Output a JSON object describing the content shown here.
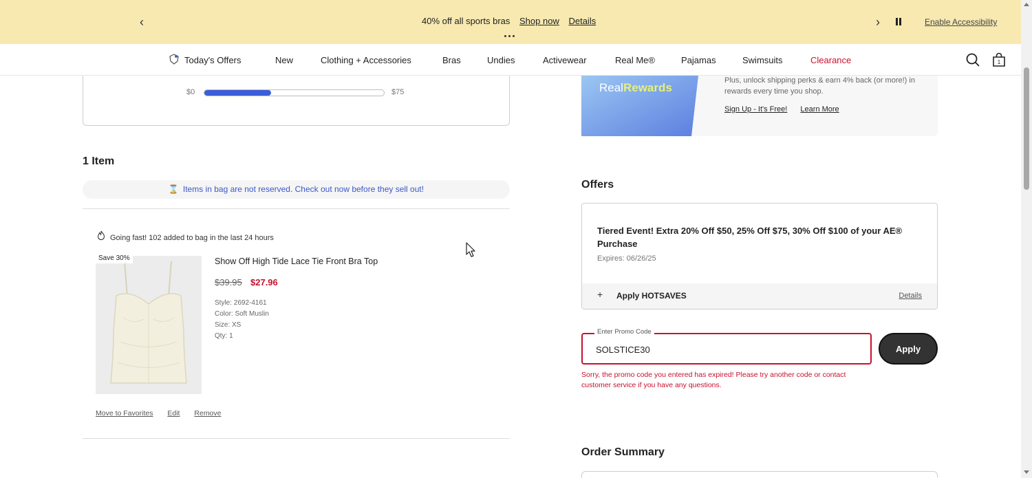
{
  "promo_bar": {
    "message": "40% off all sports bras",
    "shop_now": "Shop now",
    "details": "Details",
    "accessibility": "Enable Accessibility",
    "prev_icon": "chevron-left-icon",
    "next_icon": "chevron-right-icon",
    "pause_icon": "pause-icon"
  },
  "nav": {
    "items": [
      "Today's Offers",
      "New",
      "Clothing + Accessories",
      "Bras",
      "Undies",
      "Activewear",
      "Real Me®",
      "Pajamas",
      "Swimsuits",
      "Clearance"
    ],
    "bag_count": "1",
    "clearance_color": "#c8102e"
  },
  "progress": {
    "min_label": "$0",
    "max_label": "$75",
    "fraction": 0.37
  },
  "cart": {
    "heading": "1 Item",
    "reserve_notice": "Items in bag are not reserved. Check out now before they sell out!",
    "going_fast": "Going fast! 102 added to bag in the last 24 hours",
    "item": {
      "save_tag": "Save 30%",
      "name": "Show Off High Tide Lace Tie Front Bra Top",
      "price_old": "$39.95",
      "price_new": "$27.96",
      "style": "Style: 2692-4161",
      "color": "Color: Soft Muslin",
      "size": "Size: XS",
      "qty": "Qty: 1",
      "actions": [
        "Move to Favorites",
        "Edit",
        "Remove"
      ]
    }
  },
  "rewards": {
    "logo_text_a": "Real",
    "logo_text_b": "Rewards",
    "text": "Plus, unlock shipping perks & earn 4% back (or more!) in rewards every time you shop.",
    "sign_up": "Sign Up - It's Free!",
    "learn_more": "Learn More"
  },
  "offers": {
    "heading": "Offers",
    "title": "Tiered Event! Extra 20% Off $50, 25% Off $75, 30% Off $100 of your AE® Purchase",
    "expires": "Expires: 06/26/25",
    "apply_label": "Apply HOTSAVES",
    "details": "Details"
  },
  "promo_code": {
    "label": "Enter Promo Code",
    "value": "SOLSTICE30",
    "apply": "Apply",
    "error": "Sorry, the promo code you entered has expired! Please try another code or contact customer service if you have any questions."
  },
  "summary": {
    "heading": "Order Summary"
  },
  "colors": {
    "banner_bg": "#f7e9b0",
    "accent_blue": "#3b5ed8",
    "error_red": "#c8102e"
  }
}
